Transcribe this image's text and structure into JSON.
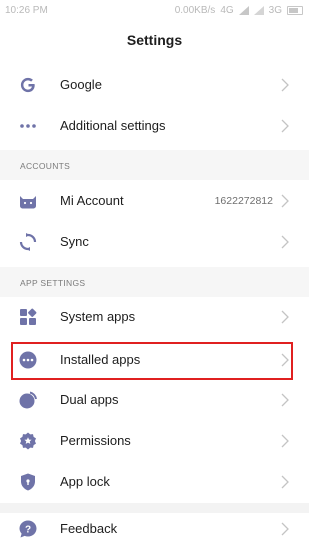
{
  "status_bar": {
    "time": "10:26 PM",
    "network": "0.00KB/s",
    "sim1": "4G",
    "sim2": "3G"
  },
  "header": {
    "title": "Settings"
  },
  "sections": {
    "accounts": "ACCOUNTS",
    "app_settings": "APP SETTINGS"
  },
  "items": {
    "google": {
      "label": "Google",
      "icon": "google-icon"
    },
    "additional": {
      "label": "Additional settings",
      "icon": "more-dots-icon"
    },
    "mi_account": {
      "label": "Mi Account",
      "value": "1622272812",
      "icon": "mi-account-icon"
    },
    "sync": {
      "label": "Sync",
      "icon": "sync-icon"
    },
    "system_apps": {
      "label": "System apps",
      "icon": "apps-grid-icon"
    },
    "installed_apps": {
      "label": "Installed apps",
      "icon": "installed-apps-icon"
    },
    "dual_apps": {
      "label": "Dual apps",
      "icon": "dual-apps-icon"
    },
    "permissions": {
      "label": "Permissions",
      "icon": "permissions-icon"
    },
    "app_lock": {
      "label": "App lock",
      "icon": "shield-lock-icon"
    },
    "feedback": {
      "label": "Feedback",
      "icon": "feedback-icon"
    }
  },
  "colors": {
    "icon": "#6f73a8",
    "highlight_border": "#e02020",
    "chevron": "#c4c4c4"
  }
}
